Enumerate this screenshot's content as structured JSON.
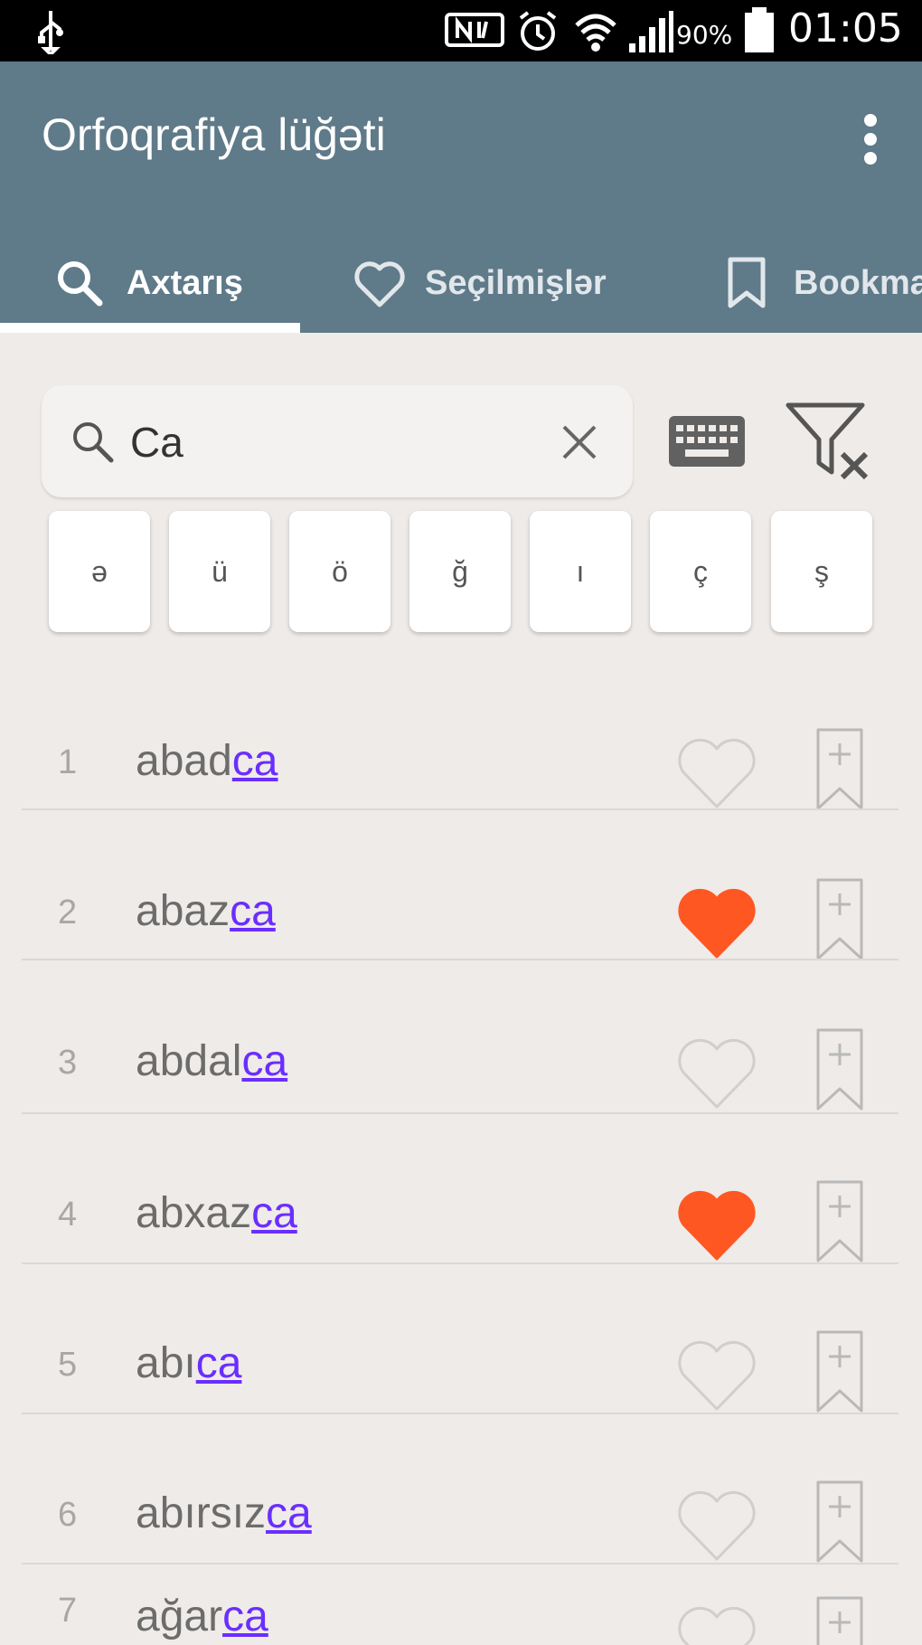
{
  "status_bar": {
    "battery": "90%",
    "time": "01:05"
  },
  "app": {
    "title": "Orfoqrafiya lüğəti"
  },
  "tabs": [
    {
      "label": "Axtarış",
      "icon": "search-icon",
      "active": true
    },
    {
      "label": "Seçilmişlər",
      "icon": "heart-outline-icon",
      "active": false
    },
    {
      "label": "Bookma",
      "icon": "bookmark-icon",
      "active": false
    }
  ],
  "search": {
    "value": "Ca"
  },
  "special_keys": [
    "ə",
    "ü",
    "ö",
    "ğ",
    "ı",
    "ç",
    "ş"
  ],
  "results": [
    {
      "num": "1",
      "prefix": "abad",
      "match": "ca",
      "favorited": false
    },
    {
      "num": "2",
      "prefix": "abaz",
      "match": "ca",
      "favorited": true
    },
    {
      "num": "3",
      "prefix": "abdal",
      "match": "ca",
      "favorited": false
    },
    {
      "num": "4",
      "prefix": "abxaz",
      "match": "ca",
      "favorited": true
    },
    {
      "num": "5",
      "prefix": "abı",
      "match": "ca",
      "favorited": false
    },
    {
      "num": "6",
      "prefix": "abırsız",
      "match": "ca",
      "favorited": false
    },
    {
      "num": "7",
      "prefix": "ağar",
      "match": "ca",
      "favorited": false
    }
  ],
  "colors": {
    "app_bar": "#5f7a89",
    "background": "#efebe8",
    "favorite_heart": "#ff5722",
    "match_highlight": "#6a2eff"
  }
}
